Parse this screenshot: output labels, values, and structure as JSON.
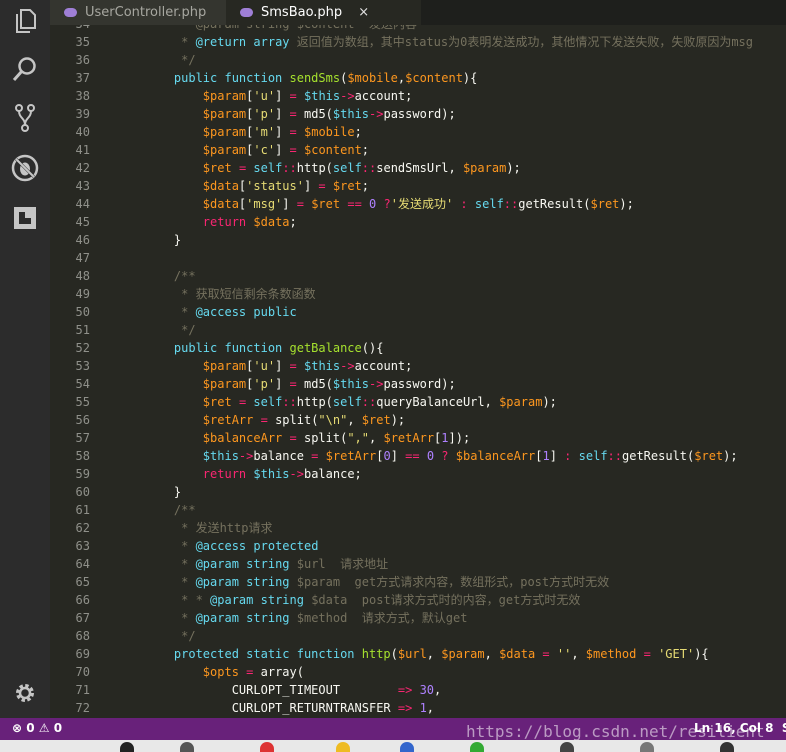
{
  "tabs": [
    {
      "label": "UserController.php",
      "active": false
    },
    {
      "label": "SmsBao.php",
      "active": true,
      "close": "×"
    }
  ],
  "activity_bar": {
    "icons": [
      "explorer-icon",
      "search-icon",
      "source-control-icon",
      "debug-icon",
      "extensions-icon",
      "settings-gear-icon"
    ]
  },
  "status_bar": {
    "problems": "⊗ 0  ⚠ 0",
    "position": "Ln 16, Col 8",
    "extra": "Sp"
  },
  "watermark": "https://blog.csdn.net/resilient",
  "colors": {
    "keyword": "#66d9ef",
    "variable": "#fd971f",
    "string": "#e6db74",
    "comment": "#75715e",
    "function": "#a6e22e",
    "operator": "#f92672",
    "constant": "#ae81ff"
  },
  "code": [
    {
      "n": "34",
      "t": [
        [
          "c",
          "     * @param string $content  发送内容"
        ]
      ]
    },
    {
      "n": "35",
      "t": [
        [
          "c",
          "     * "
        ],
        [
          "k",
          "@return"
        ],
        [
          "c",
          " "
        ],
        [
          "k",
          "array"
        ],
        [
          "c",
          " 返回值为数组，其中status为0表明发送成功，其他情况下发送失败，失败原因为msg"
        ]
      ]
    },
    {
      "n": "36",
      "t": [
        [
          "c",
          "     */"
        ]
      ]
    },
    {
      "n": "37",
      "t": [
        [
          "p",
          "    "
        ],
        [
          "k",
          "public function "
        ],
        [
          "f",
          "sendSms"
        ],
        [
          "p",
          "("
        ],
        [
          "v",
          "$mobile"
        ],
        [
          "p",
          ","
        ],
        [
          "v",
          "$content"
        ],
        [
          "p",
          "){"
        ]
      ]
    },
    {
      "n": "38",
      "t": [
        [
          "p",
          "        "
        ],
        [
          "v",
          "$param"
        ],
        [
          "p",
          "["
        ],
        [
          "s",
          "'u'"
        ],
        [
          "p",
          "] "
        ],
        [
          "o",
          "="
        ],
        [
          "p",
          " "
        ],
        [
          "k",
          "$this"
        ],
        [
          "o",
          "->"
        ],
        [
          "p",
          "account;"
        ]
      ]
    },
    {
      "n": "39",
      "t": [
        [
          "p",
          "        "
        ],
        [
          "v",
          "$param"
        ],
        [
          "p",
          "["
        ],
        [
          "s",
          "'p'"
        ],
        [
          "p",
          "] "
        ],
        [
          "o",
          "="
        ],
        [
          "p",
          " md5("
        ],
        [
          "k",
          "$this"
        ],
        [
          "o",
          "->"
        ],
        [
          "p",
          "password);"
        ]
      ]
    },
    {
      "n": "40",
      "t": [
        [
          "p",
          "        "
        ],
        [
          "v",
          "$param"
        ],
        [
          "p",
          "["
        ],
        [
          "s",
          "'m'"
        ],
        [
          "p",
          "] "
        ],
        [
          "o",
          "="
        ],
        [
          "p",
          " "
        ],
        [
          "v",
          "$mobile"
        ],
        [
          "p",
          ";"
        ]
      ]
    },
    {
      "n": "41",
      "t": [
        [
          "p",
          "        "
        ],
        [
          "v",
          "$param"
        ],
        [
          "p",
          "["
        ],
        [
          "s",
          "'c'"
        ],
        [
          "p",
          "] "
        ],
        [
          "o",
          "="
        ],
        [
          "p",
          " "
        ],
        [
          "v",
          "$content"
        ],
        [
          "p",
          ";"
        ]
      ]
    },
    {
      "n": "42",
      "t": [
        [
          "p",
          "        "
        ],
        [
          "v",
          "$ret"
        ],
        [
          "p",
          " "
        ],
        [
          "o",
          "="
        ],
        [
          "p",
          " "
        ],
        [
          "k",
          "self"
        ],
        [
          "o",
          "::"
        ],
        [
          "p",
          "http("
        ],
        [
          "k",
          "self"
        ],
        [
          "o",
          "::"
        ],
        [
          "p",
          "sendSmsUrl, "
        ],
        [
          "v",
          "$param"
        ],
        [
          "p",
          ");"
        ]
      ]
    },
    {
      "n": "43",
      "t": [
        [
          "p",
          "        "
        ],
        [
          "v",
          "$data"
        ],
        [
          "p",
          "["
        ],
        [
          "s",
          "'status'"
        ],
        [
          "p",
          "] "
        ],
        [
          "o",
          "="
        ],
        [
          "p",
          " "
        ],
        [
          "v",
          "$ret"
        ],
        [
          "p",
          ";"
        ]
      ]
    },
    {
      "n": "44",
      "t": [
        [
          "p",
          "        "
        ],
        [
          "v",
          "$data"
        ],
        [
          "p",
          "["
        ],
        [
          "s",
          "'msg'"
        ],
        [
          "p",
          "] "
        ],
        [
          "o",
          "="
        ],
        [
          "p",
          " "
        ],
        [
          "v",
          "$ret"
        ],
        [
          "p",
          " "
        ],
        [
          "o",
          "=="
        ],
        [
          "p",
          " "
        ],
        [
          "n",
          "0"
        ],
        [
          "p",
          " "
        ],
        [
          "o",
          "?"
        ],
        [
          "s",
          "'发送成功'"
        ],
        [
          "p",
          " "
        ],
        [
          "o",
          ":"
        ],
        [
          "p",
          " "
        ],
        [
          "k",
          "self"
        ],
        [
          "o",
          "::"
        ],
        [
          "p",
          "getResult("
        ],
        [
          "v",
          "$ret"
        ],
        [
          "p",
          ");"
        ]
      ]
    },
    {
      "n": "45",
      "t": [
        [
          "p",
          "        "
        ],
        [
          "o",
          "return"
        ],
        [
          "p",
          " "
        ],
        [
          "v",
          "$data"
        ],
        [
          "p",
          ";"
        ]
      ]
    },
    {
      "n": "46",
      "t": [
        [
          "p",
          "    }"
        ]
      ]
    },
    {
      "n": "47",
      "t": []
    },
    {
      "n": "48",
      "t": [
        [
          "c",
          "    /**"
        ]
      ]
    },
    {
      "n": "49",
      "t": [
        [
          "c",
          "     * 获取短信剩余条数函数"
        ]
      ]
    },
    {
      "n": "50",
      "t": [
        [
          "c",
          "     * "
        ],
        [
          "k",
          "@access"
        ],
        [
          "c",
          " "
        ],
        [
          "k",
          "public"
        ]
      ]
    },
    {
      "n": "51",
      "t": [
        [
          "c",
          "     */"
        ]
      ]
    },
    {
      "n": "52",
      "t": [
        [
          "p",
          "    "
        ],
        [
          "k",
          "public function "
        ],
        [
          "f",
          "getBalance"
        ],
        [
          "p",
          "(){"
        ]
      ]
    },
    {
      "n": "53",
      "t": [
        [
          "p",
          "        "
        ],
        [
          "v",
          "$param"
        ],
        [
          "p",
          "["
        ],
        [
          "s",
          "'u'"
        ],
        [
          "p",
          "] "
        ],
        [
          "o",
          "="
        ],
        [
          "p",
          " "
        ],
        [
          "k",
          "$this"
        ],
        [
          "o",
          "->"
        ],
        [
          "p",
          "account;"
        ]
      ]
    },
    {
      "n": "54",
      "t": [
        [
          "p",
          "        "
        ],
        [
          "v",
          "$param"
        ],
        [
          "p",
          "["
        ],
        [
          "s",
          "'p'"
        ],
        [
          "p",
          "] "
        ],
        [
          "o",
          "="
        ],
        [
          "p",
          " md5("
        ],
        [
          "k",
          "$this"
        ],
        [
          "o",
          "->"
        ],
        [
          "p",
          "password);"
        ]
      ]
    },
    {
      "n": "55",
      "t": [
        [
          "p",
          "        "
        ],
        [
          "v",
          "$ret"
        ],
        [
          "p",
          " "
        ],
        [
          "o",
          "="
        ],
        [
          "p",
          " "
        ],
        [
          "k",
          "self"
        ],
        [
          "o",
          "::"
        ],
        [
          "p",
          "http("
        ],
        [
          "k",
          "self"
        ],
        [
          "o",
          "::"
        ],
        [
          "p",
          "queryBalanceUrl, "
        ],
        [
          "v",
          "$param"
        ],
        [
          "p",
          ");"
        ]
      ]
    },
    {
      "n": "56",
      "t": [
        [
          "p",
          "        "
        ],
        [
          "v",
          "$retArr"
        ],
        [
          "p",
          " "
        ],
        [
          "o",
          "="
        ],
        [
          "p",
          " split("
        ],
        [
          "s",
          "\"\\n\""
        ],
        [
          "p",
          ", "
        ],
        [
          "v",
          "$ret"
        ],
        [
          "p",
          ");"
        ]
      ]
    },
    {
      "n": "57",
      "t": [
        [
          "p",
          "        "
        ],
        [
          "v",
          "$balanceArr"
        ],
        [
          "p",
          " "
        ],
        [
          "o",
          "="
        ],
        [
          "p",
          " split("
        ],
        [
          "s",
          "\",\""
        ],
        [
          "p",
          ", "
        ],
        [
          "v",
          "$retArr"
        ],
        [
          "p",
          "["
        ],
        [
          "n",
          "1"
        ],
        [
          "p",
          "]);"
        ]
      ]
    },
    {
      "n": "58",
      "t": [
        [
          "p",
          "        "
        ],
        [
          "k",
          "$this"
        ],
        [
          "o",
          "->"
        ],
        [
          "p",
          "balance "
        ],
        [
          "o",
          "="
        ],
        [
          "p",
          " "
        ],
        [
          "v",
          "$retArr"
        ],
        [
          "p",
          "["
        ],
        [
          "n",
          "0"
        ],
        [
          "p",
          "] "
        ],
        [
          "o",
          "=="
        ],
        [
          "p",
          " "
        ],
        [
          "n",
          "0"
        ],
        [
          "p",
          " "
        ],
        [
          "o",
          "?"
        ],
        [
          "p",
          " "
        ],
        [
          "v",
          "$balanceArr"
        ],
        [
          "p",
          "["
        ],
        [
          "n",
          "1"
        ],
        [
          "p",
          "] "
        ],
        [
          "o",
          ":"
        ],
        [
          "p",
          " "
        ],
        [
          "k",
          "self"
        ],
        [
          "o",
          "::"
        ],
        [
          "p",
          "getResult("
        ],
        [
          "v",
          "$ret"
        ],
        [
          "p",
          ");"
        ]
      ]
    },
    {
      "n": "59",
      "t": [
        [
          "p",
          "        "
        ],
        [
          "o",
          "return"
        ],
        [
          "p",
          " "
        ],
        [
          "k",
          "$this"
        ],
        [
          "o",
          "->"
        ],
        [
          "p",
          "balance;"
        ]
      ]
    },
    {
      "n": "60",
      "t": [
        [
          "p",
          "    }"
        ]
      ]
    },
    {
      "n": "61",
      "t": [
        [
          "c",
          "    /**"
        ]
      ]
    },
    {
      "n": "62",
      "t": [
        [
          "c",
          "     * 发送http请求"
        ]
      ]
    },
    {
      "n": "63",
      "t": [
        [
          "c",
          "     * "
        ],
        [
          "k",
          "@access"
        ],
        [
          "c",
          " "
        ],
        [
          "k",
          "protected"
        ]
      ]
    },
    {
      "n": "64",
      "t": [
        [
          "c",
          "     * "
        ],
        [
          "k",
          "@param"
        ],
        [
          "c",
          " "
        ],
        [
          "k",
          "string"
        ],
        [
          "c",
          " $url  请求地址"
        ]
      ]
    },
    {
      "n": "65",
      "t": [
        [
          "c",
          "     * "
        ],
        [
          "k",
          "@param"
        ],
        [
          "c",
          " "
        ],
        [
          "k",
          "string"
        ],
        [
          "c",
          " $param  get方式请求内容，数组形式，post方式时无效"
        ]
      ]
    },
    {
      "n": "66",
      "t": [
        [
          "c",
          "     * * "
        ],
        [
          "k",
          "@param"
        ],
        [
          "c",
          " "
        ],
        [
          "k",
          "string"
        ],
        [
          "c",
          " $data  post请求方式时的内容，get方式时无效"
        ]
      ]
    },
    {
      "n": "67",
      "t": [
        [
          "c",
          "     * "
        ],
        [
          "k",
          "@param"
        ],
        [
          "c",
          " "
        ],
        [
          "k",
          "string"
        ],
        [
          "c",
          " $method  请求方式，默认get"
        ]
      ]
    },
    {
      "n": "68",
      "t": [
        [
          "c",
          "     */"
        ]
      ]
    },
    {
      "n": "69",
      "t": [
        [
          "p",
          "    "
        ],
        [
          "k",
          "protected static function "
        ],
        [
          "f",
          "http"
        ],
        [
          "p",
          "("
        ],
        [
          "v",
          "$url"
        ],
        [
          "p",
          ", "
        ],
        [
          "v",
          "$param"
        ],
        [
          "p",
          ", "
        ],
        [
          "v",
          "$data"
        ],
        [
          "p",
          " "
        ],
        [
          "o",
          "="
        ],
        [
          "p",
          " "
        ],
        [
          "s",
          "''"
        ],
        [
          "p",
          ", "
        ],
        [
          "v",
          "$method"
        ],
        [
          "p",
          " "
        ],
        [
          "o",
          "="
        ],
        [
          "p",
          " "
        ],
        [
          "s",
          "'GET'"
        ],
        [
          "p",
          "){"
        ]
      ]
    },
    {
      "n": "70",
      "t": [
        [
          "p",
          "        "
        ],
        [
          "v",
          "$opts"
        ],
        [
          "p",
          " "
        ],
        [
          "o",
          "="
        ],
        [
          "p",
          " array("
        ]
      ]
    },
    {
      "n": "71",
      "t": [
        [
          "p",
          "            CURLOPT_TIMEOUT        "
        ],
        [
          "o",
          "=>"
        ],
        [
          "p",
          " "
        ],
        [
          "n",
          "30"
        ],
        [
          "p",
          ","
        ]
      ]
    },
    {
      "n": "72",
      "t": [
        [
          "p",
          "            CURLOPT_RETURNTRANSFER "
        ],
        [
          "o",
          "=>"
        ],
        [
          "p",
          " "
        ],
        [
          "n",
          "1"
        ],
        [
          "p",
          ","
        ]
      ]
    }
  ]
}
